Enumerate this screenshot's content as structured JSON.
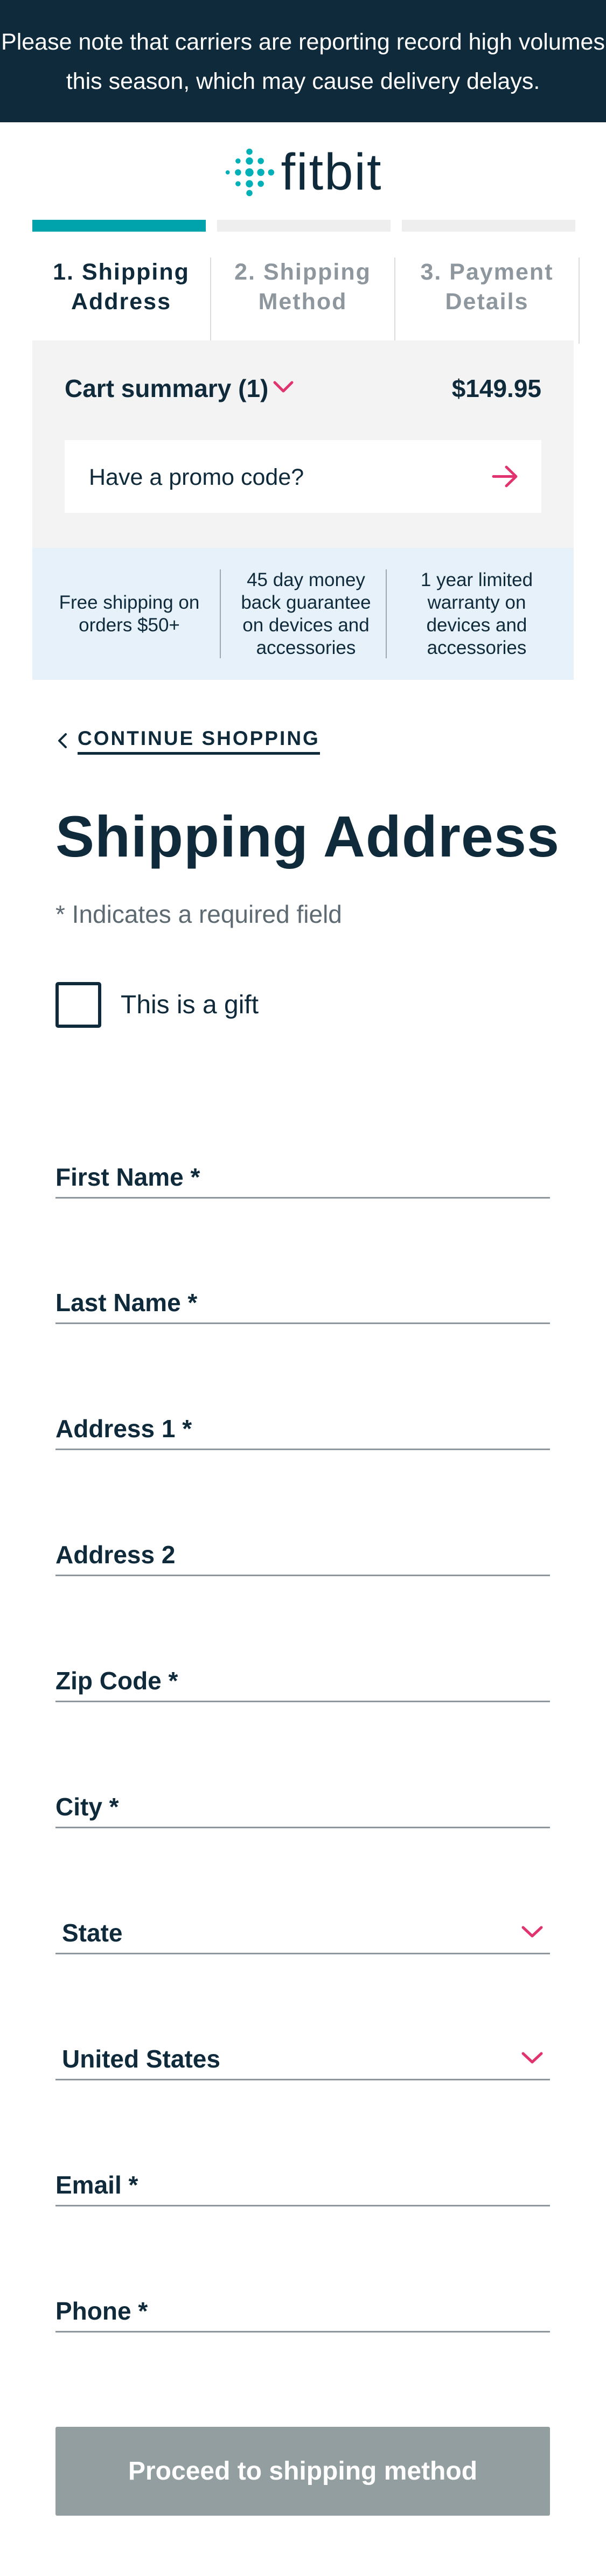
{
  "banner": {
    "text": "Please note that carriers are reporting record high volumes this season, which may cause delivery delays."
  },
  "brand": {
    "name": "fitbit",
    "logo_icon": "fitbit-dots-icon",
    "color": "#00b0b9"
  },
  "steps": [
    {
      "number": "1.",
      "line1": "1. Shipping",
      "line2": "Address",
      "state": "active"
    },
    {
      "number": "2.",
      "line1": "2. Shipping",
      "line2": "Method",
      "state": "inactive"
    },
    {
      "number": "3.",
      "line1": "3. Payment",
      "line2": "Details",
      "state": "inactive"
    }
  ],
  "cart": {
    "title": "Cart summary (1)",
    "price": "$149.95",
    "toggle_icon": "chevron-down-icon",
    "promo_label": "Have a promo code?",
    "promo_icon": "arrow-right-icon"
  },
  "perks": [
    {
      "text": "Free shipping on orders $50+"
    },
    {
      "text": "45 day money back guarantee on devices and accessories"
    },
    {
      "text": "1 year limited warranty on devices and accessories"
    }
  ],
  "nav": {
    "continue_label": "CONTINUE SHOPPING",
    "continue_icon": "chevron-left-icon"
  },
  "form": {
    "title": "Shipping Address",
    "required_note": "* Indicates a required field",
    "gift_label": "This is a gift",
    "gift_checked": false,
    "fields": {
      "first_name": "First Name *",
      "last_name": "Last Name *",
      "address1": "Address 1 *",
      "address2": "Address 2",
      "zip": "Zip Code *",
      "city": "City *",
      "state": "State",
      "country": "United States",
      "email": "Email *",
      "phone": "Phone *"
    },
    "submit_label": "Proceed to shipping method"
  },
  "colors": {
    "navy": "#0f2a3a",
    "teal": "#00b0b9",
    "pink": "#e0336f",
    "disabled_button": "#939ea0"
  }
}
